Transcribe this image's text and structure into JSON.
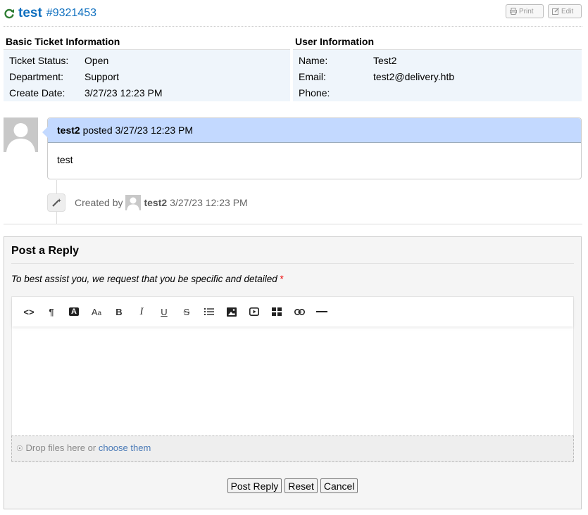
{
  "ticket": {
    "name": "test",
    "number": "#9321453",
    "print_label": "Print",
    "edit_label": "Edit"
  },
  "basic_info": {
    "heading": "Basic Ticket Information",
    "rows": [
      {
        "key": "Ticket Status:",
        "value": "Open"
      },
      {
        "key": "Department:",
        "value": "Support"
      },
      {
        "key": "Create Date:",
        "value": "3/27/23 12:23 PM"
      }
    ]
  },
  "user_info": {
    "heading": "User Information",
    "rows": [
      {
        "key": "Name:",
        "value": "Test2"
      },
      {
        "key": "Email:",
        "value": "test2@delivery.htb"
      },
      {
        "key": "Phone:",
        "value": ""
      }
    ]
  },
  "message": {
    "author": "test2",
    "posted_text": "posted 3/27/23 12:23 PM",
    "body": "test"
  },
  "event": {
    "prefix": "Created by",
    "user": "test2",
    "time": "3/27/23 12:23 PM"
  },
  "reply": {
    "heading": "Post a Reply",
    "instruction": "To best assist you, we request that you be specific and detailed",
    "required_mark": "*",
    "drop_text": "Drop files here or",
    "drop_link": "choose them",
    "post_label": "Post Reply",
    "reset_label": "Reset",
    "cancel_label": "Cancel"
  },
  "toolbar_icons": [
    "code-view-icon",
    "paragraph-icon",
    "text-color-icon",
    "font-size-icon",
    "bold-icon",
    "italic-icon",
    "underline-icon",
    "strikethrough-icon",
    "list-icon",
    "image-icon",
    "video-icon",
    "table-icon",
    "link-icon",
    "horizontal-rule-icon"
  ],
  "colors": {
    "title_green": "#2e7d32",
    "title_blue": "#0e6fbf",
    "info_bg": "#eff5fb",
    "message_header": "#c3d9ff"
  }
}
